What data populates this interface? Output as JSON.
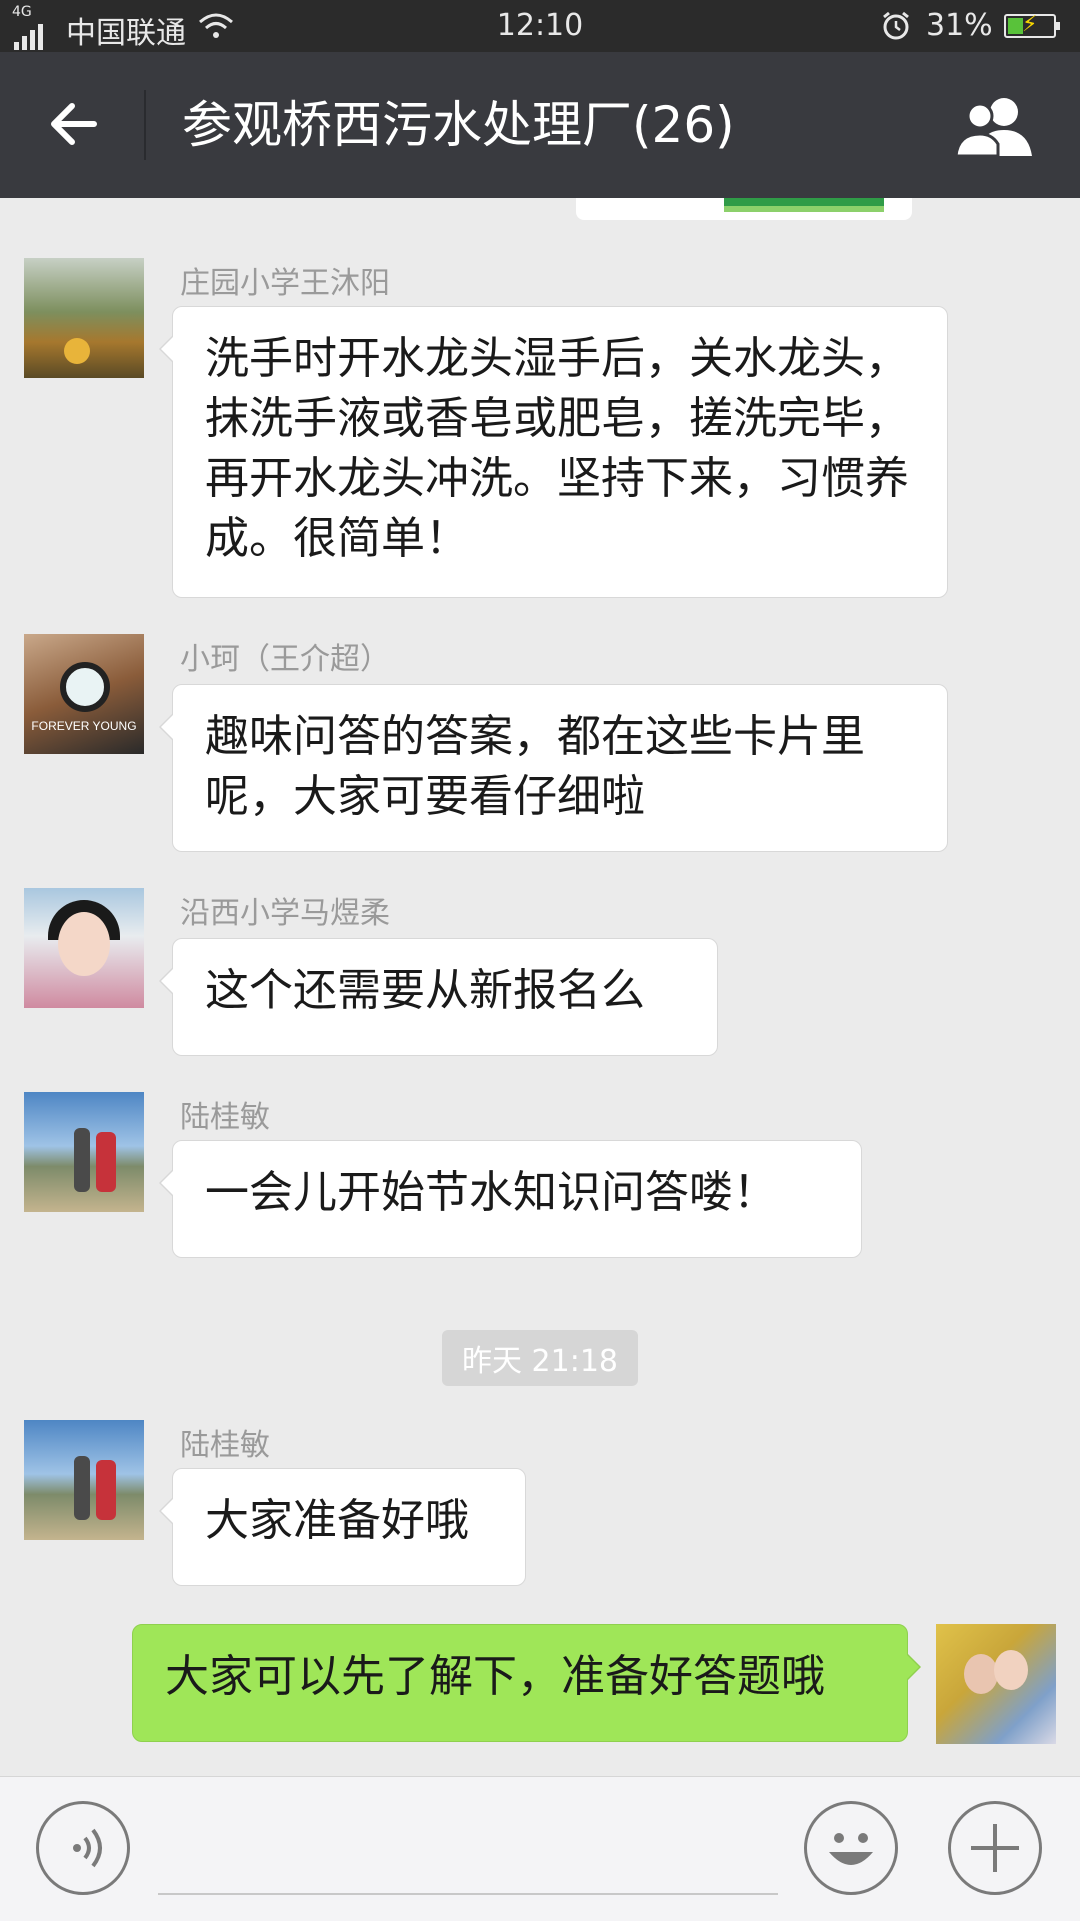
{
  "status_bar": {
    "network": "4G",
    "carrier": "中国联通",
    "time": "12:10",
    "battery_pct": "31%",
    "battery_level": 0.31
  },
  "header": {
    "title": "参观桥西污水处理厂(26)"
  },
  "messages": [
    {
      "sender": "庄园小学王沐阳",
      "text": "洗手时开水龙头湿手后，关水龙头，抹洗手液或香皂或肥皂，搓洗完毕，再开水龙头冲洗。坚持下来，习惯养成。很简单！"
    },
    {
      "sender": "小珂（王介超）",
      "text": "趣味问答的答案，都在这些卡片里呢，大家可要看仔细啦",
      "avatar_text": "FOREVER YOUNG"
    },
    {
      "sender": "沿西小学马煜柔",
      "text": "这个还需要从新报名么"
    },
    {
      "sender": "陆桂敏",
      "text": "一会儿开始节水知识问答喽！"
    },
    {
      "sender": "陆桂敏",
      "text": "大家准备好哦"
    },
    {
      "sender": "me",
      "text": "大家可以先了解下，准备好答题哦"
    }
  ],
  "timestamp": "昨天 21:18",
  "input": {
    "value": "",
    "placeholder": ""
  },
  "colors": {
    "header_bg": "#393a3f",
    "my_bubble": "#9fe658",
    "chat_bg": "#ebebeb"
  },
  "icons": [
    "back-arrow-icon",
    "group-members-icon",
    "voice-icon",
    "emoji-icon",
    "plus-icon",
    "wifi-icon",
    "alarm-icon",
    "battery-icon"
  ]
}
